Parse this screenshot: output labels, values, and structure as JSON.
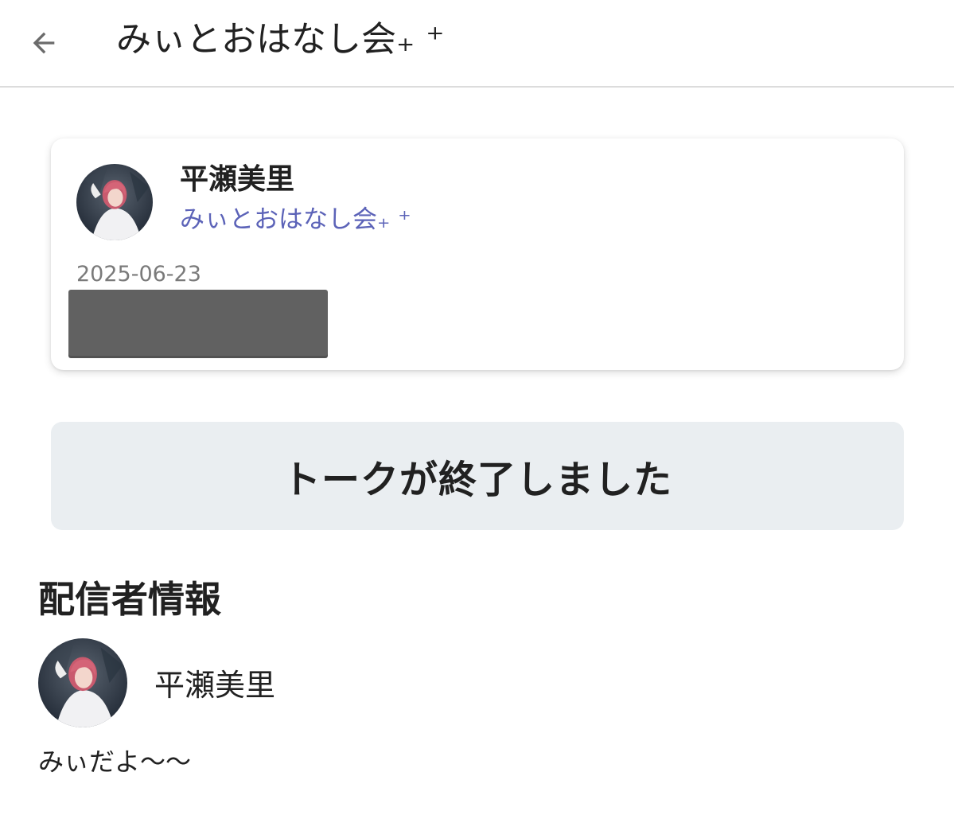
{
  "appbar": {
    "title": "みぃとおはなし会₊ ⁺"
  },
  "card": {
    "name": "平瀬美里",
    "subtitle": "みぃとおはなし会₊ ⁺",
    "date": "2025-06-23"
  },
  "status": {
    "ended_label": "トークが終了しました"
  },
  "host_section": {
    "title": "配信者情報",
    "name": "平瀬美里",
    "bio": "みぃだよ〜〜"
  },
  "colors": {
    "accent": "#5c63b8",
    "banner_bg": "#eaeef1",
    "redaction": "#616161"
  }
}
